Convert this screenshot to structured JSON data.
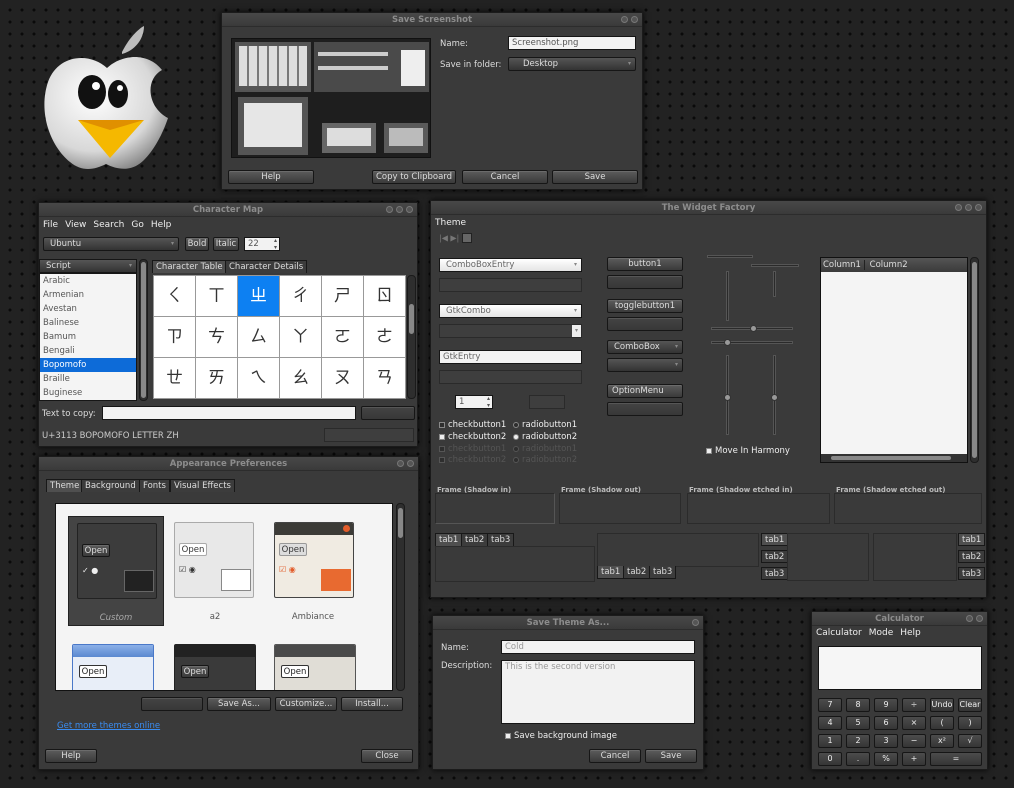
{
  "screenshot_dialog": {
    "title": "Save Screenshot",
    "name_label": "Name:",
    "name_value": "Screenshot.png",
    "folder_label": "Save in folder:",
    "folder_value": "Desktop",
    "buttons": {
      "help": "Help",
      "copy": "Copy to Clipboard",
      "cancel": "Cancel",
      "save": "Save"
    }
  },
  "char_map": {
    "title": "Character Map",
    "menu": [
      "File",
      "View",
      "Search",
      "Go",
      "Help"
    ],
    "font": "Ubuntu",
    "bold": "Bold",
    "italic": "Italic",
    "size": "22",
    "script_header": "Script",
    "scripts": [
      "Arabic",
      "Armenian",
      "Avestan",
      "Balinese",
      "Bamum",
      "Bengali",
      "Bopomofo",
      "Braille",
      "Buginese"
    ],
    "selected_script": "Bopomofo",
    "tabs": [
      "Character Table",
      "Character Details"
    ],
    "chars": [
      "ㄑ",
      "ㄒ",
      "ㄓ",
      "ㄔ",
      "ㄕ",
      "ㄖ",
      "ㄗ",
      "ㄘ",
      "ㄙ",
      "ㄚ",
      "ㄛ",
      "ㄜ",
      "ㄝ",
      "ㄞ",
      "ㄟ",
      "ㄠ",
      "ㄡ",
      "ㄢ"
    ],
    "selected_index": 2,
    "text_to_copy_label": "Text to copy:",
    "status": "U+3113 BOPOMOFO LETTER ZH"
  },
  "widget_factory": {
    "title": "The Widget Factory",
    "menu": "Theme",
    "combobox_entry": "ComboBoxEntry",
    "gtkcombo": "GtkCombo",
    "gtkentry": "GtkEntry",
    "spin_value": "1",
    "checks": [
      "checkbutton1",
      "checkbutton2"
    ],
    "radios": [
      "radiobutton1",
      "radiobutton2"
    ],
    "buttons": {
      "button1": "button1",
      "toggle": "togglebutton1",
      "combobox": "ComboBox",
      "optionmenu": "OptionMenu"
    },
    "move_harmony": "Move In Harmony",
    "columns": [
      "Column1",
      "Column2"
    ],
    "frames": [
      "Frame (Shadow in)",
      "Frame (Shadow out)",
      "Frame (Shadow etched in)",
      "Frame (Shadow etched out)"
    ],
    "tabs": [
      "tab1",
      "tab2",
      "tab3"
    ]
  },
  "appearance": {
    "title": "Appearance Preferences",
    "tabs": [
      "Theme",
      "Background",
      "Fonts",
      "Visual Effects"
    ],
    "themes": [
      {
        "name": "Custom",
        "open": "Open"
      },
      {
        "name": "a2",
        "open": "Open"
      },
      {
        "name": "Ambiance",
        "open": "Open"
      },
      {
        "name": "",
        "open": "Open"
      },
      {
        "name": "",
        "open": "Open"
      },
      {
        "name": "",
        "open": "Open"
      }
    ],
    "buttons": {
      "save_as": "Save As...",
      "customize": "Customize...",
      "install": "Install..."
    },
    "link": "Get more themes online",
    "help": "Help",
    "close": "Close"
  },
  "save_theme": {
    "title": "Save Theme As...",
    "name_label": "Name:",
    "name_value": "Cold",
    "desc_label": "Description:",
    "desc_value": "This is the second version",
    "bg_check": "Save background image",
    "cancel": "Cancel",
    "save": "Save"
  },
  "calculator": {
    "title": "Calculator",
    "menu": [
      "Calculator",
      "Mode",
      "Help"
    ],
    "rows": [
      [
        "7",
        "8",
        "9",
        "÷",
        "Undo",
        "Clear"
      ],
      [
        "4",
        "5",
        "6",
        "×",
        "(",
        ")"
      ],
      [
        "1",
        "2",
        "3",
        "−",
        "x²",
        "√"
      ],
      [
        "0",
        ".",
        "%",
        "+",
        "="
      ]
    ]
  },
  "colors": {
    "selection": "#0d6bd8",
    "link": "#3a8cf0"
  }
}
